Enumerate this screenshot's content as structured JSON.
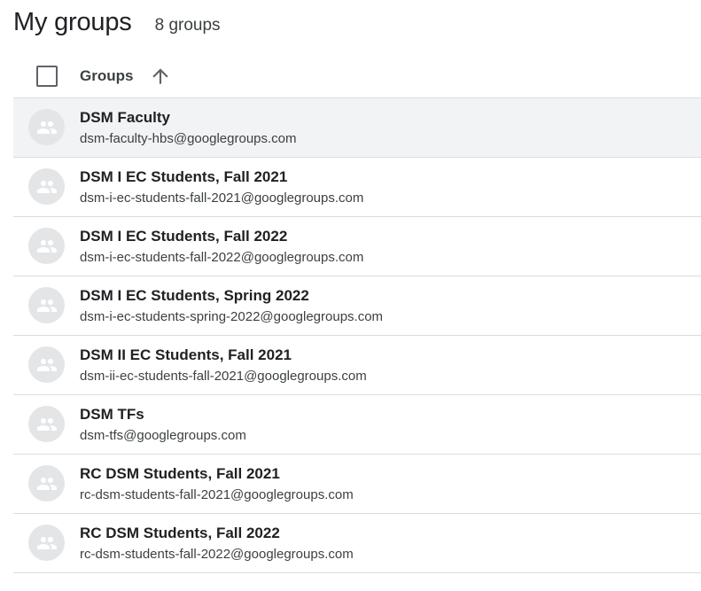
{
  "header": {
    "title": "My groups",
    "count": "8 groups"
  },
  "table": {
    "column_label": "Groups",
    "sort_icon": "arrow-up-icon",
    "select_all_icon": "checkbox-icon"
  },
  "groups": [
    {
      "name": "DSM Faculty",
      "email": "dsm-faculty-hbs@googlegroups.com",
      "avatar_icon": "group-icon"
    },
    {
      "name": "DSM I EC Students, Fall 2021",
      "email": "dsm-i-ec-students-fall-2021@googlegroups.com",
      "avatar_icon": "group-icon"
    },
    {
      "name": "DSM I EC Students, Fall 2022",
      "email": "dsm-i-ec-students-fall-2022@googlegroups.com",
      "avatar_icon": "group-icon"
    },
    {
      "name": "DSM I EC Students, Spring 2022",
      "email": "dsm-i-ec-students-spring-2022@googlegroups.com",
      "avatar_icon": "group-icon"
    },
    {
      "name": "DSM II EC Students, Fall 2021",
      "email": "dsm-ii-ec-students-fall-2021@googlegroups.com",
      "avatar_icon": "group-icon"
    },
    {
      "name": "DSM TFs",
      "email": "dsm-tfs@googlegroups.com",
      "avatar_icon": "group-icon"
    },
    {
      "name": "RC DSM Students, Fall 2021",
      "email": "rc-dsm-students-fall-2021@googlegroups.com",
      "avatar_icon": "group-icon"
    },
    {
      "name": "RC DSM Students, Fall 2022",
      "email": "rc-dsm-students-fall-2022@googlegroups.com",
      "avatar_icon": "group-icon"
    }
  ],
  "colors": {
    "hover_row": "#f1f3f4",
    "divider": "#dadce0",
    "avatar_bg": "#e4e5e7",
    "avatar_icon": "#ffffff"
  }
}
